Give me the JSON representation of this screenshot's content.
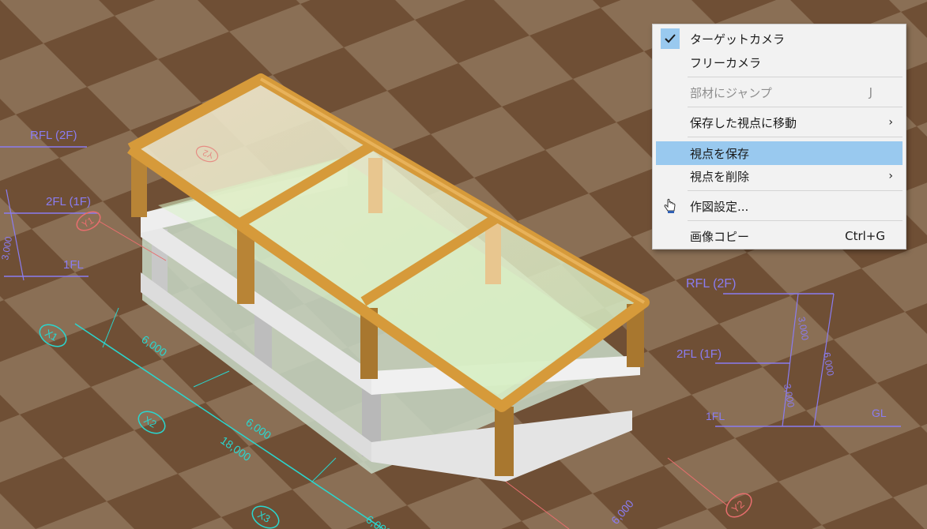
{
  "menu": {
    "items": [
      {
        "label": "ターゲットカメラ",
        "checked": true,
        "icon": "check-icon"
      },
      {
        "label": "フリーカメラ"
      },
      {
        "label": "部材にジャンプ",
        "shortcut": "J",
        "disabled": true
      },
      {
        "label": "保存した視点に移動",
        "submenu": "›"
      },
      {
        "label": "視点を保存",
        "highlighted": true
      },
      {
        "label": "視点を削除",
        "submenu": "›"
      },
      {
        "label": "作図設定...",
        "icon": "hand-pointer-icon"
      },
      {
        "label": "画像コピー",
        "shortcut": "Ctrl+G"
      }
    ]
  },
  "view": {
    "left_levels": [
      "RFL (2F)",
      "2FL (1F)",
      "1FL"
    ],
    "left_dim": "3,000",
    "grid_left": [
      "X1",
      "X2",
      "X3",
      "Y1"
    ],
    "dims_front": [
      "6,000",
      "6,000",
      "18,000",
      "6,000",
      "6,000"
    ],
    "right_levels": [
      "RFL (2F)",
      "2FL (1F)",
      "1FL",
      "GL"
    ],
    "right_dims": [
      "3,000",
      "3,000",
      "6,000"
    ],
    "grid_right": [
      "Y2"
    ],
    "top_bubble": "Y2"
  },
  "colors": {
    "floor_dark": "#6f4f35",
    "floor_light": "#8a6f55",
    "beam_orange": "#d69a3a",
    "menu_highlight": "#99c9ef",
    "dim_blue": "#8a7cf0",
    "grid_cyan": "#29d7d0",
    "grid_red": "#e86e6e"
  }
}
